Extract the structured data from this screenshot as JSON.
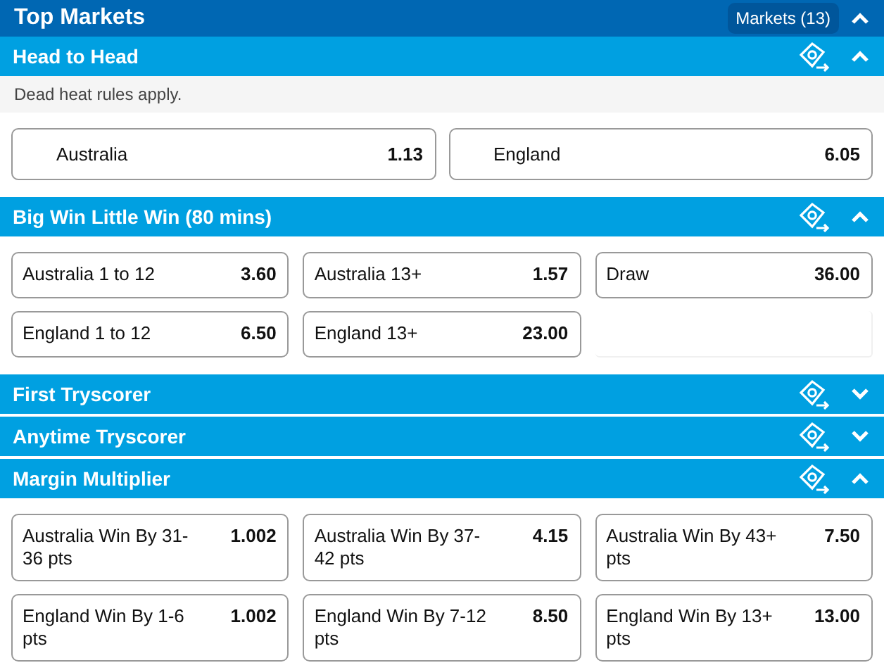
{
  "header": {
    "title": "Top Markets",
    "markets_button": "Markets (13)",
    "expanded": true
  },
  "sections": [
    {
      "title": "Head to Head",
      "expanded": true,
      "note": "Dead heat rules apply.",
      "options": [
        {
          "kind": "odds",
          "label": "Australia",
          "odds": "1.13"
        },
        {
          "kind": "odds",
          "label": "England",
          "odds": "6.05"
        }
      ]
    },
    {
      "title": "Big Win Little Win (80 mins)",
      "expanded": true,
      "options": [
        {
          "kind": "odds",
          "label": "Australia 1 to 12",
          "odds": "3.60"
        },
        {
          "kind": "odds",
          "label": "Australia 13+",
          "odds": "1.57"
        },
        {
          "kind": "odds",
          "label": "Draw",
          "odds": "36.00"
        },
        {
          "kind": "odds",
          "label": "England 1 to 12",
          "odds": "6.50"
        },
        {
          "kind": "odds",
          "label": "England 13+",
          "odds": "23.00"
        },
        {
          "kind": "empty"
        }
      ]
    },
    {
      "title": "First Tryscorer",
      "expanded": false
    },
    {
      "title": "Anytime Tryscorer",
      "expanded": false
    },
    {
      "title": "Margin Multiplier",
      "expanded": true,
      "options": [
        {
          "kind": "odds",
          "label": "Australia Win By 31-36 pts",
          "odds": "1.002"
        },
        {
          "kind": "odds",
          "label": "Australia Win By 37-42 pts",
          "odds": "4.15"
        },
        {
          "kind": "odds",
          "label": "Australia Win By 43+ pts",
          "odds": "7.50"
        },
        {
          "kind": "odds",
          "label": "England Win By 1-6 pts",
          "odds": "1.002"
        },
        {
          "kind": "odds",
          "label": "England Win By 7-12 pts",
          "odds": "8.50"
        },
        {
          "kind": "odds",
          "label": "England Win By 13+ pts",
          "odds": "13.00"
        }
      ]
    }
  ]
}
